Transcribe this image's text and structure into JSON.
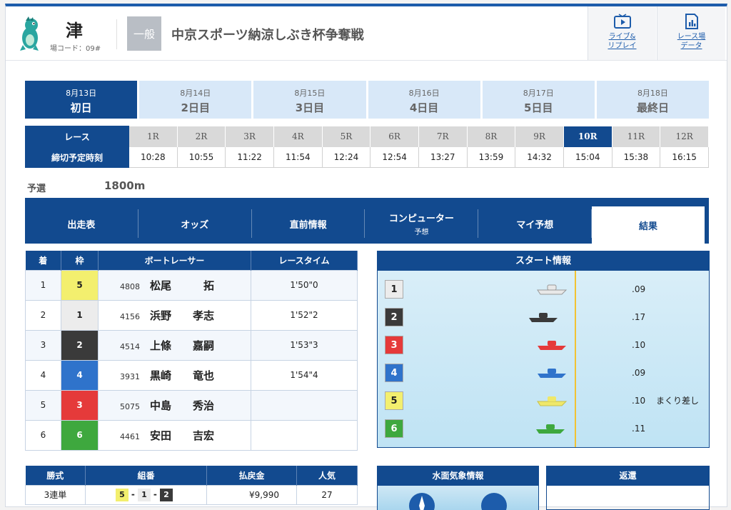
{
  "header": {
    "venue": "津",
    "venue_code": "場コード：09#",
    "grade": "一般",
    "race_name": "中京スポーツ納涼しぶき杯争奪戦",
    "buttons": [
      {
        "label1": "ライブ&",
        "label2": "リプレイ",
        "icon": "tv-play-icon"
      },
      {
        "label1": "レース場",
        "label2": "データ",
        "icon": "data-chart-icon"
      }
    ]
  },
  "days": [
    {
      "date": "8月13日",
      "name": "初日"
    },
    {
      "date": "8月14日",
      "name": "2日目"
    },
    {
      "date": "8月15日",
      "name": "3日目"
    },
    {
      "date": "8月16日",
      "name": "4日目"
    },
    {
      "date": "8月17日",
      "name": "5日目"
    },
    {
      "date": "8月18日",
      "name": "最終日"
    }
  ],
  "race_table": {
    "race_label": "レース",
    "deadline_label": "締切予定時刻",
    "races": [
      "1R",
      "2R",
      "3R",
      "4R",
      "5R",
      "6R",
      "7R",
      "8R",
      "9R",
      "10R",
      "11R",
      "12R"
    ],
    "times": [
      "10:28",
      "10:55",
      "11:22",
      "11:54",
      "12:24",
      "12:54",
      "13:27",
      "13:59",
      "14:32",
      "15:04",
      "15:38",
      "16:15"
    ],
    "current": "10R"
  },
  "race_class": "予選",
  "distance": "1800m",
  "info_tabs": [
    {
      "label": "出走表"
    },
    {
      "label": "オッズ"
    },
    {
      "label": "直前情報"
    },
    {
      "label": "コンピューター",
      "sub": "予想"
    },
    {
      "label": "マイ予想"
    },
    {
      "label": "結果"
    }
  ],
  "results": {
    "headers": [
      "着",
      "枠",
      "ボートレーサー",
      "レースタイム"
    ],
    "rows": [
      {
        "rank": "1",
        "frame": "5",
        "reg": "4808",
        "name": "松尾　　　拓",
        "time": "1'50\"0"
      },
      {
        "rank": "2",
        "frame": "1",
        "reg": "4156",
        "name": "浜野　　孝志",
        "time": "1'52\"2"
      },
      {
        "rank": "3",
        "frame": "2",
        "reg": "4514",
        "name": "上條　　嘉嗣",
        "time": "1'53\"3"
      },
      {
        "rank": "4",
        "frame": "4",
        "reg": "3931",
        "name": "黒崎　　竜也",
        "time": "1'54\"4"
      },
      {
        "rank": "5",
        "frame": "3",
        "reg": "5075",
        "name": "中島　　秀治",
        "time": ""
      },
      {
        "rank": "6",
        "frame": "6",
        "reg": "4461",
        "name": "安田　　吉宏",
        "time": ""
      }
    ]
  },
  "start_info": {
    "title": "スタート情報",
    "rows": [
      {
        "lane": "1",
        "st": ".09",
        "note": ""
      },
      {
        "lane": "2",
        "st": ".17",
        "note": ""
      },
      {
        "lane": "3",
        "st": ".10",
        "note": ""
      },
      {
        "lane": "4",
        "st": ".09",
        "note": ""
      },
      {
        "lane": "5",
        "st": ".10",
        "note": "まくり差し"
      },
      {
        "lane": "6",
        "st": ".11",
        "note": ""
      }
    ]
  },
  "payout": {
    "headers": [
      "勝式",
      "組番",
      "払戻金",
      "人気"
    ],
    "rows": [
      {
        "type": "3連単",
        "combo": [
          "5",
          "1",
          "2"
        ],
        "amount": "¥9,990",
        "pop": "27"
      }
    ]
  },
  "weather": {
    "title": "水面気象情報"
  },
  "refund": {
    "title": "返還"
  },
  "colors": {
    "primary": "#124a8f",
    "accent": "#1d5cab"
  }
}
